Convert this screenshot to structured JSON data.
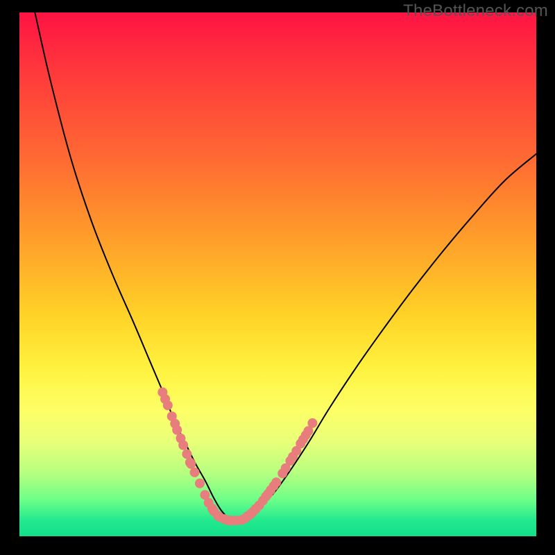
{
  "watermark": "TheBottleneck.com",
  "colors": {
    "frame": "#000000",
    "curve": "#000000",
    "marker_fill": "#e77d7d",
    "marker_stroke": "#c65b5b",
    "watermark_text": "#555555"
  },
  "chart_data": {
    "type": "line",
    "title": "",
    "xlabel": "",
    "ylabel": "",
    "xlim": [
      0,
      100
    ],
    "ylim": [
      0,
      100
    ],
    "grid": false,
    "legend": false,
    "series": [
      {
        "name": "curve",
        "kind": "line",
        "x": [
          3,
          6,
          10,
          14,
          18,
          22,
          25,
          28,
          30,
          32,
          34,
          36,
          37.5,
          39,
          40.5,
          42,
          44,
          46,
          49,
          52,
          56,
          60,
          65,
          70,
          76,
          82,
          88,
          94,
          100
        ],
        "y": [
          100,
          87,
          72,
          60,
          50,
          41,
          34,
          27,
          22,
          18,
          14,
          10.5,
          7.5,
          5,
          3.5,
          3,
          3.5,
          5,
          8,
          12,
          18,
          24.5,
          32,
          39,
          47,
          54.5,
          61.5,
          68,
          73
        ]
      },
      {
        "name": "markers-left",
        "kind": "scatter",
        "x": [
          27.7,
          28.2,
          28.7,
          29.5,
          30.1,
          30.5,
          31.2,
          31.7,
          32.4,
          33.0,
          33.2,
          33.9,
          34.9,
          35.9,
          36.6,
          37.3,
          37.6,
          38.4,
          38.7,
          39.6,
          40.1,
          40.7,
          41.1,
          42.0
        ],
        "y": [
          27.5,
          26.2,
          25.0,
          22.9,
          21.5,
          20.3,
          18.7,
          17.4,
          15.7,
          14.1,
          13.8,
          12.2,
          10.1,
          7.9,
          6.4,
          5.3,
          4.8,
          3.9,
          3.7,
          3.3,
          3.1,
          3.0,
          3.0,
          3.0
        ]
      },
      {
        "name": "markers-right",
        "kind": "scatter",
        "x": [
          43.0,
          43.6,
          44.1,
          44.7,
          45.1,
          45.7,
          46.4,
          47.1,
          47.7,
          48.1,
          48.6,
          49.2,
          49.7,
          50.9,
          51.5,
          52.4,
          52.9,
          53.6,
          54.4,
          54.9,
          55.4,
          55.9,
          56.7
        ],
        "y": [
          3.1,
          3.4,
          3.8,
          4.2,
          4.6,
          5.2,
          5.9,
          6.8,
          7.6,
          8.1,
          8.8,
          9.6,
          10.3,
          12.0,
          13.0,
          14.4,
          15.2,
          16.3,
          17.7,
          18.5,
          19.3,
          20.1,
          21.6
        ]
      }
    ]
  }
}
